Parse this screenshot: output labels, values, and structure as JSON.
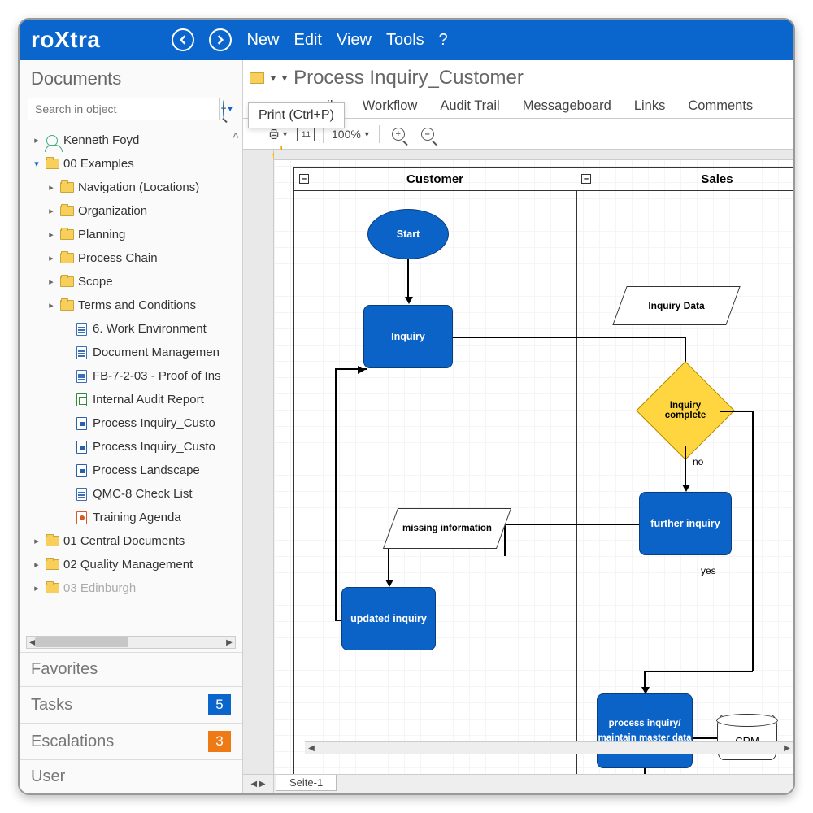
{
  "app": {
    "logo_prefix": "ro",
    "logo_mid": "X",
    "logo_suffix": "tra"
  },
  "menu": {
    "new": "New",
    "edit": "Edit",
    "view": "View",
    "tools": "Tools",
    "help": "?"
  },
  "sidebar": {
    "title": "Documents",
    "search_placeholder": "Search in object",
    "tree": {
      "user": "Kenneth Foyd",
      "root": "00 Examples",
      "folders": [
        "Navigation (Locations)",
        "Organization",
        "Planning",
        "Process Chain",
        "Scope",
        "Terms and Conditions"
      ],
      "docs": [
        {
          "label": "6. Work Environment",
          "kind": "word"
        },
        {
          "label": "Document Managemen",
          "kind": "word"
        },
        {
          "label": "FB-7-2-03 - Proof of Ins",
          "kind": "word"
        },
        {
          "label": "Internal Audit Report",
          "kind": "xls"
        },
        {
          "label": "Process Inquiry_Custo",
          "kind": "vis"
        },
        {
          "label": "Process Inquiry_Custo",
          "kind": "vis"
        },
        {
          "label": "Process Landscape",
          "kind": "vis"
        },
        {
          "label": "QMC-8 Check List",
          "kind": "word"
        },
        {
          "label": "Training Agenda",
          "kind": "pp"
        }
      ],
      "tail_folders": [
        "01 Central Documents",
        "02 Quality Management",
        "03 Edinburgh"
      ]
    },
    "sections": {
      "favorites": "Favorites",
      "tasks": "Tasks",
      "tasks_count": "5",
      "escalations": "Escalations",
      "esc_count": "3",
      "user": "User"
    }
  },
  "main": {
    "title": "Process Inquiry_Customer",
    "tabs": [
      "ails",
      "Workflow",
      "Audit Trail",
      "Messageboard",
      "Links",
      "Comments"
    ],
    "tooltip": "Print (Ctrl+P)",
    "zoom": "100%",
    "page_tab": "Seite-1"
  },
  "flow": {
    "lanes": [
      "Customer",
      "Sales"
    ],
    "start": "Start",
    "inquiry": "Inquiry",
    "inquiry_data": "Inquiry Data",
    "decision": "Inquiry complete",
    "no": "no",
    "yes": "yes",
    "further": "further inquiry",
    "missing": "missing information",
    "updated": "updated inquiry",
    "process": "process inquiry/",
    "maintain": "maintain master data",
    "crm": "CRM"
  }
}
